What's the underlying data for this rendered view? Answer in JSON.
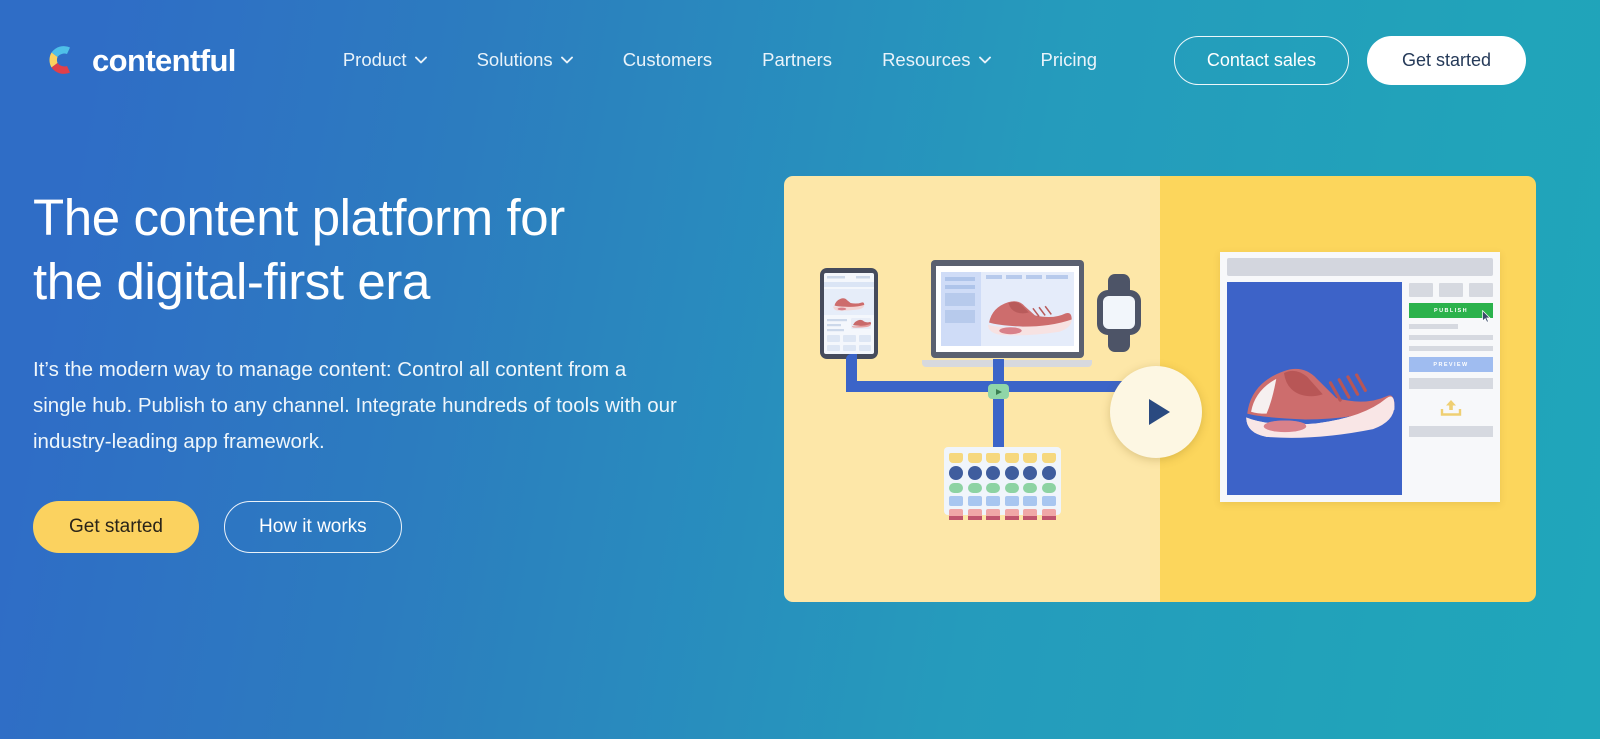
{
  "brand": {
    "name": "contentful",
    "logo_colors": {
      "cyan": "#4fc0e8",
      "yellow": "#fbd25f",
      "red": "#e0404a",
      "blue": "#2f6dc6"
    }
  },
  "nav": {
    "items": [
      {
        "label": "Product",
        "has_dropdown": true
      },
      {
        "label": "Solutions",
        "has_dropdown": true
      },
      {
        "label": "Customers",
        "has_dropdown": false
      },
      {
        "label": "Partners",
        "has_dropdown": false
      },
      {
        "label": "Resources",
        "has_dropdown": true
      },
      {
        "label": "Pricing",
        "has_dropdown": false
      }
    ],
    "contact_sales": "Contact sales",
    "get_started": "Get started"
  },
  "hero": {
    "title_line1": "The content platform for",
    "title_line2": "the digital-first era",
    "subtitle": "It’s the modern way to manage content: Control all content from a single hub. Publish to any channel. Integrate hundreds of tools with our industry-leading app framework.",
    "primary_cta": "Get started",
    "secondary_cta": "How it works"
  },
  "illustration": {
    "panel_left_color": "#fde7a8",
    "panel_right_color": "#fcd65c",
    "devices": [
      "phone",
      "laptop",
      "smartwatch"
    ],
    "play_button": "play-video",
    "browser": {
      "publish_label": "PUBLISH",
      "preview_label": "PREVIEW",
      "publish_color": "#2bb24c",
      "preview_color": "#9fbcf0",
      "canvas_color": "#3d63c8",
      "upload_icon": "upload-icon",
      "cursor": "mouse-cursor"
    },
    "content_grid": {
      "rows": [
        {
          "type": "tag",
          "count": 6,
          "color": "#f6d87e"
        },
        {
          "type": "dot",
          "count": 6,
          "color": "#3f5d9e"
        },
        {
          "type": "pill",
          "count": 6,
          "color": "#8dd3a3"
        },
        {
          "type": "sq",
          "count": 6,
          "color": "#a8c6f0"
        },
        {
          "type": "card",
          "count": 6,
          "color": "#f0a7a7"
        }
      ]
    }
  },
  "theme": {
    "bg_gradient_from": "#2f6dc6",
    "bg_gradient_to": "#20a6bb",
    "accent_yellow": "#fbd25f",
    "text_on_dark": "#ffffff",
    "dark_navy": "#253a59"
  }
}
